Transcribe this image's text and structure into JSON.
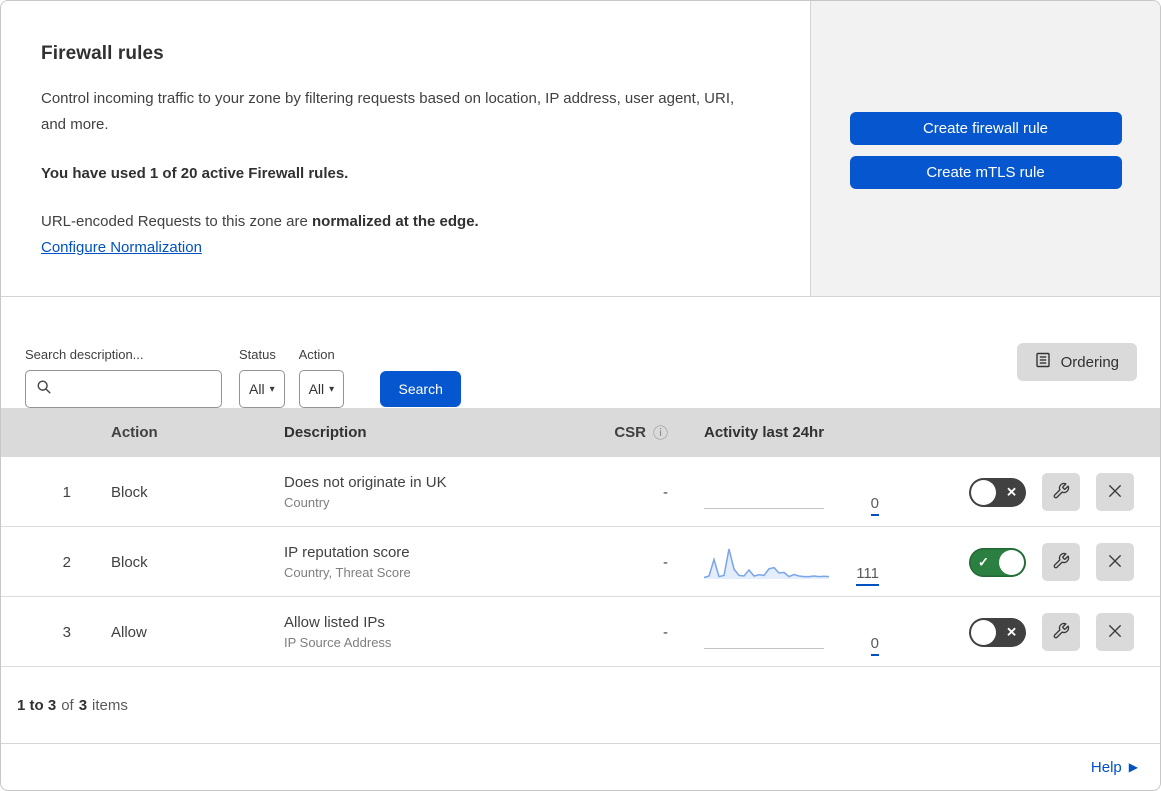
{
  "header": {
    "title": "Firewall rules",
    "description": "Control incoming traffic to your zone by filtering requests based on location, IP address, user agent, URI, and more.",
    "usage_note": "You have used 1 of 20 active Firewall rules.",
    "normalization_prefix": "URL-encoded Requests to this zone are ",
    "normalization_bold": "normalized at the edge.",
    "normalization_link": "Configure Normalization",
    "create_firewall_button": "Create firewall rule",
    "create_mtls_button": "Create mTLS rule"
  },
  "filters": {
    "search_label": "Search description...",
    "status_label": "Status",
    "status_value": "All",
    "action_label": "Action",
    "action_value": "All",
    "search_button": "Search",
    "ordering_button": "Ordering"
  },
  "table": {
    "columns": {
      "action": "Action",
      "description": "Description",
      "csr": "CSR",
      "activity": "Activity last 24hr"
    },
    "rows": [
      {
        "number": "1",
        "action": "Block",
        "description": "Does not originate in UK",
        "fields": "Country",
        "csr": "-",
        "activity_count": "0",
        "enabled": false,
        "sparkline": null
      },
      {
        "number": "2",
        "action": "Block",
        "description": "IP reputation score",
        "fields": "Country, Threat Score",
        "csr": "-",
        "activity_count": "111",
        "enabled": true,
        "sparkline": [
          5,
          10,
          65,
          8,
          12,
          100,
          33,
          12,
          10,
          30,
          10,
          14,
          12,
          34,
          38,
          20,
          22,
          8,
          15,
          10,
          8,
          8,
          10,
          8,
          9,
          8
        ]
      },
      {
        "number": "3",
        "action": "Allow",
        "description": "Allow listed IPs",
        "fields": "IP Source Address",
        "csr": "-",
        "activity_count": "0",
        "enabled": false,
        "sparkline": null
      }
    ]
  },
  "footer": {
    "range": "1 to 3",
    "of": "of",
    "total": "3",
    "items": "items"
  },
  "help": {
    "label": "Help"
  },
  "icons": {
    "dropdown_caret": "▾",
    "info": "ⓘ",
    "check": "✓",
    "cross": "✕",
    "help_arrow": "▶"
  },
  "colors": {
    "primary_blue": "#0656cf",
    "link_blue": "#0051c3",
    "toggle_on_green": "#2b7f41",
    "toggle_off_gray": "#414141",
    "spark_stroke": "#7aa5e9",
    "spark_fill": "#e4edfa",
    "table_header_gray": "#dadada"
  }
}
